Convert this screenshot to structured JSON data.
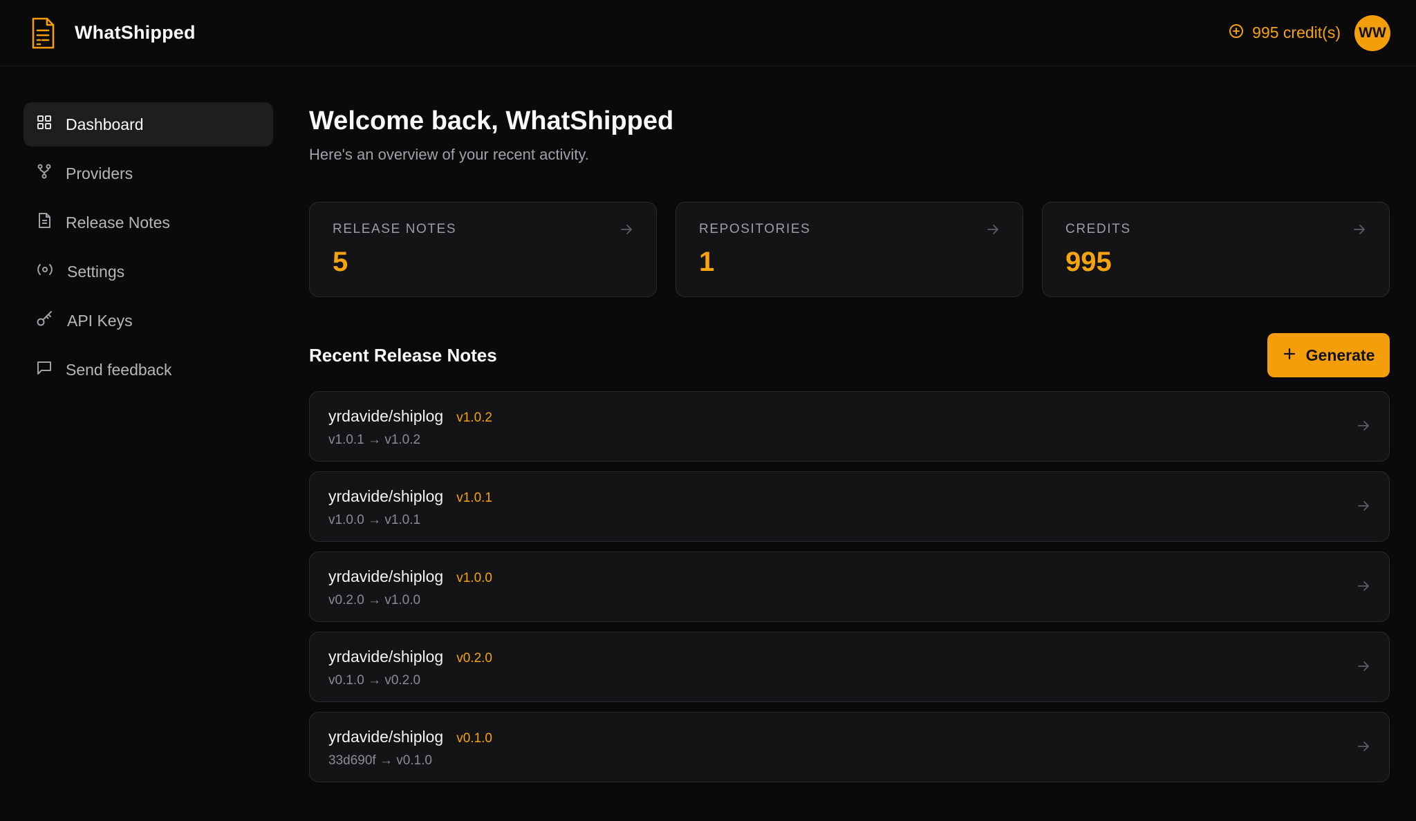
{
  "app": {
    "name": "WhatShipped",
    "credits_label": "995 credit(s)",
    "avatar_initials": "WW",
    "accent_color": "#f59e0b"
  },
  "sidebar": {
    "items": [
      {
        "label": "Dashboard",
        "icon": "grid-icon",
        "active": true
      },
      {
        "label": "Providers",
        "icon": "git-fork-icon",
        "active": false
      },
      {
        "label": "Release Notes",
        "icon": "file-text-icon",
        "active": false
      },
      {
        "label": "Settings",
        "icon": "radio-settings-icon",
        "active": false
      },
      {
        "label": "API Keys",
        "icon": "key-icon",
        "active": false
      },
      {
        "label": "Send feedback",
        "icon": "message-square-icon",
        "active": false
      }
    ]
  },
  "main": {
    "title": "Welcome back, WhatShipped",
    "subtitle": "Here's an overview of your recent activity.",
    "stats": [
      {
        "label": "RELEASE NOTES",
        "value": "5"
      },
      {
        "label": "REPOSITORIES",
        "value": "1"
      },
      {
        "label": "CREDITS",
        "value": "995"
      }
    ],
    "recent_title": "Recent Release Notes",
    "generate_label": "Generate",
    "notes": [
      {
        "repo": "yrdavide/shiplog",
        "tag": "v1.0.2",
        "range": "v1.0.1 → v1.0.2"
      },
      {
        "repo": "yrdavide/shiplog",
        "tag": "v1.0.1",
        "range": "v1.0.0 → v1.0.1"
      },
      {
        "repo": "yrdavide/shiplog",
        "tag": "v1.0.0",
        "range": "v0.2.0 → v1.0.0"
      },
      {
        "repo": "yrdavide/shiplog",
        "tag": "v0.2.0",
        "range": "v0.1.0 → v0.2.0"
      },
      {
        "repo": "yrdavide/shiplog",
        "tag": "v0.1.0",
        "range": "33d690f → v0.1.0"
      }
    ]
  }
}
